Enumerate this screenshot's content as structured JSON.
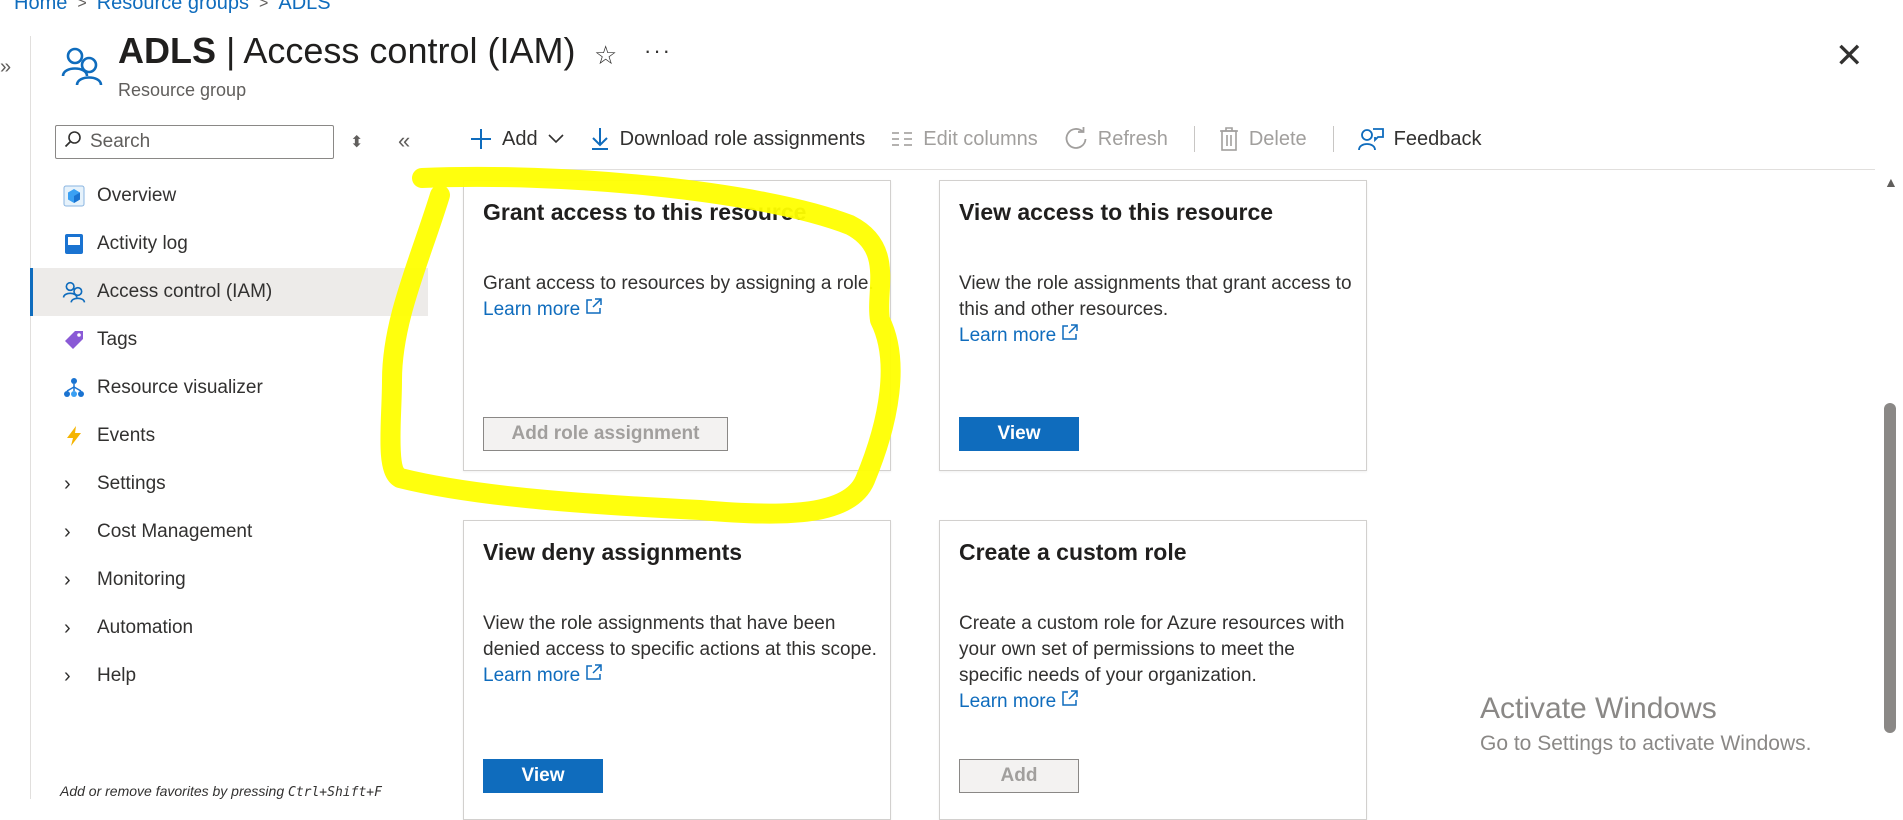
{
  "breadcrumb": {
    "items": [
      "Home",
      "Resource groups",
      "ADLS"
    ],
    "separator": ">"
  },
  "header": {
    "resource_name": "ADLS",
    "title_separator": "|",
    "page_name": "Access control (IAM)",
    "subtitle": "Resource group",
    "star_icon": "☆",
    "more_icon": "···",
    "close_icon": "✕"
  },
  "rail": {
    "expand_icon": "»"
  },
  "sidebar": {
    "search_placeholder": "Search",
    "sort_icon": "⬍",
    "collapse_icon": "«",
    "items": [
      {
        "label": "Overview",
        "icon": "overview-icon"
      },
      {
        "label": "Activity log",
        "icon": "activity-log-icon"
      },
      {
        "label": "Access control (IAM)",
        "icon": "iam-icon",
        "active": true
      },
      {
        "label": "Tags",
        "icon": "tag-icon"
      },
      {
        "label": "Resource visualizer",
        "icon": "visualizer-icon"
      },
      {
        "label": "Events",
        "icon": "events-icon"
      },
      {
        "label": "Settings",
        "expandable": true
      },
      {
        "label": "Cost Management",
        "expandable": true
      },
      {
        "label": "Monitoring",
        "expandable": true
      },
      {
        "label": "Automation",
        "expandable": true
      },
      {
        "label": "Help",
        "expandable": true
      }
    ],
    "footer_prefix": "Add or remove favorites by pressing ",
    "footer_shortcut": "Ctrl+Shift+F"
  },
  "toolbar": {
    "add": "Add",
    "download": "Download role assignments",
    "edit_columns": "Edit columns",
    "refresh": "Refresh",
    "delete": "Delete",
    "feedback": "Feedback"
  },
  "cards": [
    {
      "title": "Grant access to this resource",
      "desc_before": "Grant access to resources by assigning a role.",
      "learn_more": "Learn more",
      "button": "Add role assignment",
      "button_disabled": true
    },
    {
      "title": "View access to this resource",
      "desc_before": "View the role assignments that grant access to this and other resources.",
      "learn_more": "Learn more",
      "button": "View",
      "button_disabled": false
    },
    {
      "title": "View deny assignments",
      "desc_before": "View the role assignments that have been denied access to specific actions at this scope.",
      "learn_more": "Learn more",
      "button": "View",
      "button_disabled": false
    },
    {
      "title": "Create a custom role",
      "desc_before": "Create a custom role for Azure resources with your own set of permissions to meet the specific needs of your organization.",
      "learn_more": "Learn more",
      "button": "Add",
      "button_disabled": true
    }
  ],
  "watermark": {
    "line1": "Activate Windows",
    "line2": "Go to Settings to activate Windows."
  },
  "colors": {
    "accent": "#0f6cbd",
    "highlight": "#ffff00",
    "disabled": "#a19f9d"
  }
}
